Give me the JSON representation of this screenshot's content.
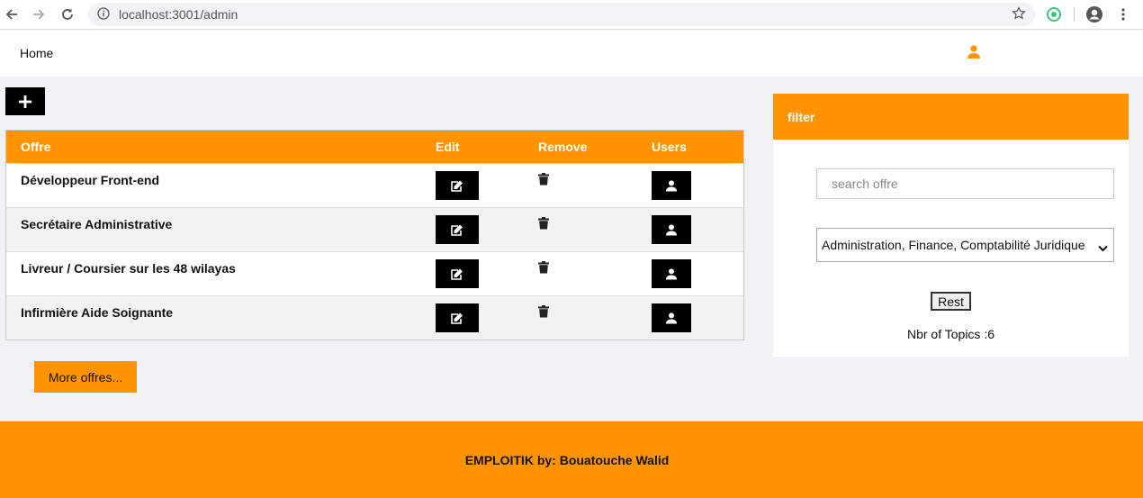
{
  "browser": {
    "url": "localhost:3001/admin"
  },
  "navbar": {
    "home_label": "Home"
  },
  "table": {
    "headers": {
      "offre": "Offre",
      "edit": "Edit",
      "remove": "Remove",
      "users": "Users"
    },
    "rows": [
      {
        "title": "Développeur Front-end"
      },
      {
        "title": "Secrétaire Administrative"
      },
      {
        "title": "Livreur / Coursier sur les 48 wilayas"
      },
      {
        "title": "Infirmière Aide Soignante"
      }
    ]
  },
  "more_label": "More offres...",
  "filter": {
    "title": "filter",
    "search_placeholder": "search offre",
    "selected_category": "Administration, Finance, Comptabilité Juridique",
    "reset_label": "Rest",
    "count_text": "Nbr of Topics :6"
  },
  "footer": {
    "text": "EMPLOITIK by: Bouatouche Walid"
  },
  "colors": {
    "accent": "#ff9400",
    "dark": "#000000",
    "background": "#f0f2f6"
  }
}
